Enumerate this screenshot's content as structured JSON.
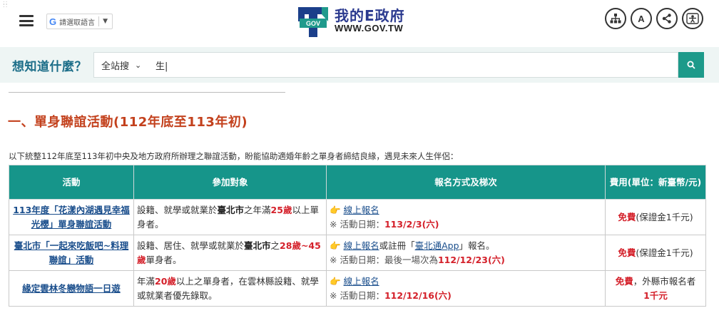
{
  "header": {
    "translate_label": "請選取語言",
    "translate_caret": "▼",
    "logo_title": "我的E政府",
    "logo_url": "WWW.GOV.TW",
    "logo_mark_text": "GOV",
    "font_size_label": "A"
  },
  "search": {
    "label": "想知道什麼？",
    "scope": "全站搜",
    "query": "生|"
  },
  "content": {
    "heading": "一、單身聯誼活動(112年底至113年初)",
    "intro": "以下統整112年底至113年初中央及地方政府所辦理之聯誼活動，盼能協助適婚年齡之單身者締結良緣，遇見未來人生伴侶："
  },
  "table": {
    "headers": [
      "活動",
      "參加對象",
      "報名方式及梯次",
      "費用(單位：新臺幣/元)"
    ],
    "rows": [
      {
        "name": "113年度「花漾內湖遇見幸福光櫻」單身聯誼活動",
        "target_a": "設籍、就學或就業於",
        "target_city": "臺北市",
        "target_b": "之年滿",
        "target_age": "25歲",
        "target_c": "以上單身者。",
        "signup_link": "線上報名",
        "signup_rest": "",
        "signup_link2": "",
        "signup_rest2": "",
        "date_prefix": "※ 活動日期：",
        "date_value": "113/2/3(六)",
        "fee_red": "免費",
        "fee_rest": "(保證金1千元)",
        "fee_red2": ""
      },
      {
        "name": "臺北市「一起來吃飯吧~料理聯誼」活動",
        "target_a": "設籍、居住、就學或就業於",
        "target_city": "臺北市",
        "target_b": "之",
        "target_age": "28歲~45歲",
        "target_c": "單身者。",
        "signup_link": "線上報名",
        "signup_rest": "或註冊「",
        "signup_link2": "臺北通App",
        "signup_rest2": "」報名。",
        "date_prefix": "※ 活動日期：最後一場次為",
        "date_value": "112/12/23(六)",
        "fee_red": "免費",
        "fee_rest": "(保證金1千元)",
        "fee_red2": ""
      },
      {
        "name": "緣定雲林冬戀物語一日遊",
        "target_a": "年滿",
        "target_city": "",
        "target_b": "",
        "target_age": "20歲",
        "target_c": "以上之單身者，在雲林縣設籍、就學或就業者優先錄取。",
        "signup_link": "線上報名",
        "signup_rest": "",
        "signup_link2": "",
        "signup_rest2": "",
        "date_prefix": "※ 活動日期：",
        "date_value": "112/12/16(六)",
        "fee_red": "免費",
        "fee_rest": "，外縣市報名者",
        "fee_red2": "1千元"
      }
    ]
  },
  "colors": {
    "brand_blue": "#2b3a8f",
    "teal": "#16958a",
    "heading_red": "#c3411d",
    "accent_red": "#d4202a",
    "link_blue": "#1a4e8c"
  },
  "icons": {
    "menu": "hamburger-icon",
    "sitemap": "sitemap-icon",
    "font_size": "font-size-icon",
    "share": "share-icon",
    "accessibility": "accessibility-icon",
    "search": "search-icon",
    "pointer": "pointing-hand-icon"
  }
}
